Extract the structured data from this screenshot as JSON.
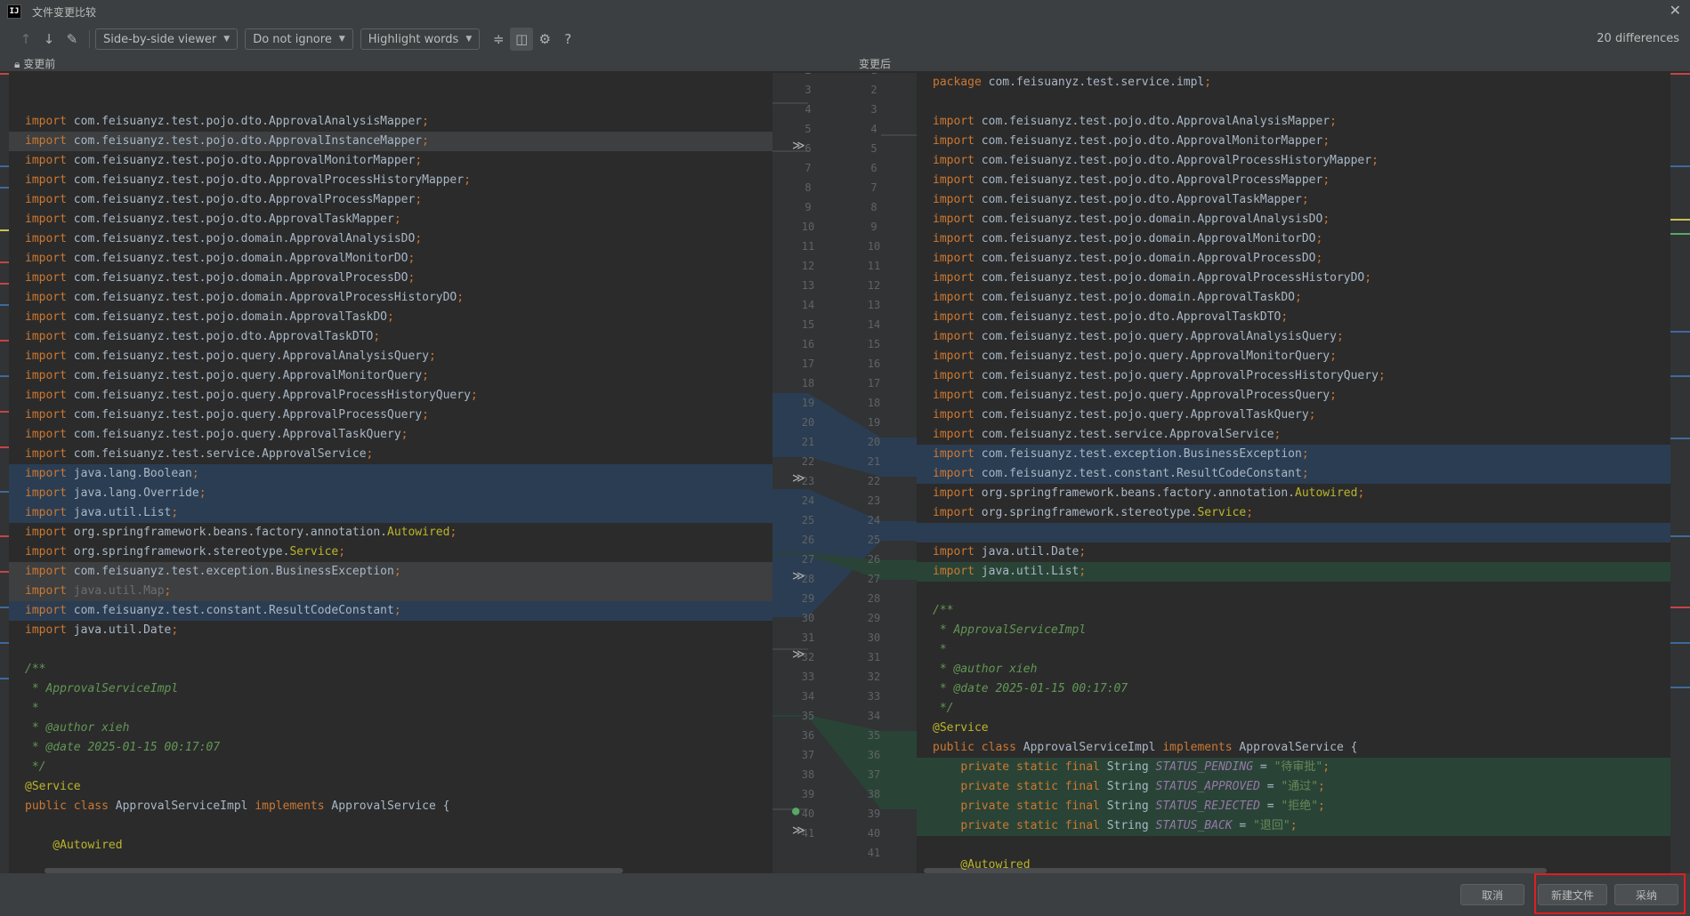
{
  "window": {
    "title": "文件变更比较",
    "logo": "IJ"
  },
  "toolbar": {
    "viewer": "Side-by-side viewer",
    "ignore": "Do not ignore",
    "highlight": "Highlight words",
    "differences": "20 differences"
  },
  "panes": {
    "left_title": "变更前",
    "right_title": "变更后"
  },
  "left_lines": [
    {
      "n": "",
      "text": "package com.feisuanyz.test.service.impl;",
      "hl": "gray"
    },
    {
      "n": "2",
      "text": "package com.feisuanyz.test.service.impl;",
      "hl": ""
    },
    {
      "n": "3",
      "text": "",
      "hl": ""
    },
    {
      "n": "4",
      "text": "import com.feisuanyz.test.pojo.dto.ApprovalAnalysisMapper;",
      "hl": ""
    },
    {
      "n": "5",
      "text": "import com.feisuanyz.test.pojo.dto.ApprovalInstanceMapper;",
      "hl": "gray"
    },
    {
      "n": "6",
      "text": "import com.feisuanyz.test.pojo.dto.ApprovalMonitorMapper;",
      "hl": ""
    },
    {
      "n": "7",
      "text": "import com.feisuanyz.test.pojo.dto.ApprovalProcessHistoryMapper;",
      "hl": ""
    },
    {
      "n": "8",
      "text": "import com.feisuanyz.test.pojo.dto.ApprovalProcessMapper;",
      "hl": ""
    },
    {
      "n": "9",
      "text": "import com.feisuanyz.test.pojo.dto.ApprovalTaskMapper;",
      "hl": ""
    },
    {
      "n": "10",
      "text": "import com.feisuanyz.test.pojo.domain.ApprovalAnalysisDO;",
      "hl": ""
    },
    {
      "n": "11",
      "text": "import com.feisuanyz.test.pojo.domain.ApprovalMonitorDO;",
      "hl": ""
    },
    {
      "n": "12",
      "text": "import com.feisuanyz.test.pojo.domain.ApprovalProcessDO;",
      "hl": ""
    },
    {
      "n": "13",
      "text": "import com.feisuanyz.test.pojo.domain.ApprovalProcessHistoryDO;",
      "hl": ""
    },
    {
      "n": "14",
      "text": "import com.feisuanyz.test.pojo.domain.ApprovalTaskDO;",
      "hl": ""
    },
    {
      "n": "15",
      "text": "import com.feisuanyz.test.pojo.dto.ApprovalTaskDTO;",
      "hl": ""
    },
    {
      "n": "16",
      "text": "import com.feisuanyz.test.pojo.query.ApprovalAnalysisQuery;",
      "hl": ""
    },
    {
      "n": "17",
      "text": "import com.feisuanyz.test.pojo.query.ApprovalMonitorQuery;",
      "hl": ""
    },
    {
      "n": "18",
      "text": "import com.feisuanyz.test.pojo.query.ApprovalProcessHistoryQuery;",
      "hl": ""
    },
    {
      "n": "19",
      "text": "import com.feisuanyz.test.pojo.query.ApprovalProcessQuery;",
      "hl": ""
    },
    {
      "n": "20",
      "text": "import com.feisuanyz.test.pojo.query.ApprovalTaskQuery;",
      "hl": ""
    },
    {
      "n": "21",
      "text": "import com.feisuanyz.test.service.ApprovalService;",
      "hl": ""
    },
    {
      "n": "22",
      "text": "import java.lang.Boolean;",
      "hl": "blue"
    },
    {
      "n": "23",
      "text": "import java.lang.Override;",
      "hl": "blue"
    },
    {
      "n": "24",
      "text": "import java.util.List;",
      "hl": "blue"
    },
    {
      "n": "25",
      "text": "import org.springframework.beans.factory.annotation.Autowired;",
      "hl": ""
    },
    {
      "n": "26",
      "text": "import org.springframework.stereotype.Service;",
      "hl": ""
    },
    {
      "n": "27",
      "text": "import com.feisuanyz.test.exception.BusinessException;",
      "hl": "gray"
    },
    {
      "n": "28",
      "text": "import java.util.Map;",
      "hl": "gray"
    },
    {
      "n": "29",
      "text": "import com.feisuanyz.test.constant.ResultCodeConstant;",
      "hl": "blue"
    },
    {
      "n": "30",
      "text": "import java.util.Date;",
      "hl": ""
    },
    {
      "n": "31",
      "text": "",
      "hl": ""
    },
    {
      "n": "32",
      "text": "/**",
      "hl": ""
    },
    {
      "n": "33",
      "text": " * ApprovalServiceImpl",
      "hl": ""
    },
    {
      "n": "34",
      "text": " *",
      "hl": ""
    },
    {
      "n": "35",
      "text": " * @author xieh",
      "hl": ""
    },
    {
      "n": "36",
      "text": " * @date 2025-01-15 00:17:07",
      "hl": ""
    },
    {
      "n": "37",
      "text": " */",
      "hl": ""
    },
    {
      "n": "38",
      "text": "@Service",
      "hl": ""
    },
    {
      "n": "39",
      "text": "public class ApprovalServiceImpl implements ApprovalService {",
      "hl": ""
    },
    {
      "n": "40",
      "text": "",
      "hl": ""
    },
    {
      "n": "41",
      "text": "    @Autowired",
      "hl": ""
    }
  ],
  "right_lines": [
    {
      "n": "1",
      "text": "package com.feisuanyz.test.service.impl;",
      "hl": ""
    },
    {
      "n": "2",
      "text": "",
      "hl": ""
    },
    {
      "n": "3",
      "text": "import com.feisuanyz.test.pojo.dto.ApprovalAnalysisMapper;",
      "hl": ""
    },
    {
      "n": "4",
      "text": "import com.feisuanyz.test.pojo.dto.ApprovalMonitorMapper;",
      "hl": ""
    },
    {
      "n": "5",
      "text": "import com.feisuanyz.test.pojo.dto.ApprovalProcessHistoryMapper;",
      "hl": ""
    },
    {
      "n": "6",
      "text": "import com.feisuanyz.test.pojo.dto.ApprovalProcessMapper;",
      "hl": ""
    },
    {
      "n": "7",
      "text": "import com.feisuanyz.test.pojo.dto.ApprovalTaskMapper;",
      "hl": ""
    },
    {
      "n": "8",
      "text": "import com.feisuanyz.test.pojo.domain.ApprovalAnalysisDO;",
      "hl": ""
    },
    {
      "n": "9",
      "text": "import com.feisuanyz.test.pojo.domain.ApprovalMonitorDO;",
      "hl": ""
    },
    {
      "n": "10",
      "text": "import com.feisuanyz.test.pojo.domain.ApprovalProcessDO;",
      "hl": ""
    },
    {
      "n": "11",
      "text": "import com.feisuanyz.test.pojo.domain.ApprovalProcessHistoryDO;",
      "hl": ""
    },
    {
      "n": "12",
      "text": "import com.feisuanyz.test.pojo.domain.ApprovalTaskDO;",
      "hl": ""
    },
    {
      "n": "13",
      "text": "import com.feisuanyz.test.pojo.dto.ApprovalTaskDTO;",
      "hl": ""
    },
    {
      "n": "14",
      "text": "import com.feisuanyz.test.pojo.query.ApprovalAnalysisQuery;",
      "hl": ""
    },
    {
      "n": "15",
      "text": "import com.feisuanyz.test.pojo.query.ApprovalMonitorQuery;",
      "hl": ""
    },
    {
      "n": "16",
      "text": "import com.feisuanyz.test.pojo.query.ApprovalProcessHistoryQuery;",
      "hl": ""
    },
    {
      "n": "17",
      "text": "import com.feisuanyz.test.pojo.query.ApprovalProcessQuery;",
      "hl": ""
    },
    {
      "n": "18",
      "text": "import com.feisuanyz.test.pojo.query.ApprovalTaskQuery;",
      "hl": ""
    },
    {
      "n": "19",
      "text": "import com.feisuanyz.test.service.ApprovalService;",
      "hl": ""
    },
    {
      "n": "20",
      "text": "import com.feisuanyz.test.exception.BusinessException;",
      "hl": "blue"
    },
    {
      "n": "21",
      "text": "import com.feisuanyz.test.constant.ResultCodeConstant;",
      "hl": "blue"
    },
    {
      "n": "22",
      "text": "import org.springframework.beans.factory.annotation.Autowired;",
      "hl": ""
    },
    {
      "n": "23",
      "text": "import org.springframework.stereotype.Service;",
      "hl": ""
    },
    {
      "n": "24",
      "text": "",
      "hl": "blue"
    },
    {
      "n": "25",
      "text": "import java.util.Date;",
      "hl": ""
    },
    {
      "n": "26",
      "text": "import java.util.List;",
      "hl": "green"
    },
    {
      "n": "27",
      "text": "",
      "hl": ""
    },
    {
      "n": "28",
      "text": "/**",
      "hl": ""
    },
    {
      "n": "29",
      "text": " * ApprovalServiceImpl",
      "hl": ""
    },
    {
      "n": "30",
      "text": " *",
      "hl": ""
    },
    {
      "n": "31",
      "text": " * @author xieh",
      "hl": ""
    },
    {
      "n": "32",
      "text": " * @date 2025-01-15 00:17:07",
      "hl": ""
    },
    {
      "n": "33",
      "text": " */",
      "hl": ""
    },
    {
      "n": "34",
      "text": "@Service",
      "hl": ""
    },
    {
      "n": "35",
      "text": "public class ApprovalServiceImpl implements ApprovalService {",
      "hl": ""
    },
    {
      "n": "36",
      "text": "    private static final String STATUS_PENDING = \"待审批\";",
      "hl": "green"
    },
    {
      "n": "37",
      "text": "    private static final String STATUS_APPROVED = \"通过\";",
      "hl": "green"
    },
    {
      "n": "38",
      "text": "    private static final String STATUS_REJECTED = \"拒绝\";",
      "hl": "green"
    },
    {
      "n": "39",
      "text": "    private static final String STATUS_BACK = \"退回\";",
      "hl": "green"
    },
    {
      "n": "40",
      "text": "",
      "hl": ""
    },
    {
      "n": "41",
      "text": "    @Autowired",
      "hl": ""
    }
  ],
  "footer": {
    "cancel": "取消",
    "new_file": "新建文件",
    "accept": "采纳"
  },
  "colors": {
    "accent_red": "#e01e1e",
    "changed_blue": "#2b3d52",
    "added_green": "#294436",
    "modified_gray": "#3d3f41"
  }
}
